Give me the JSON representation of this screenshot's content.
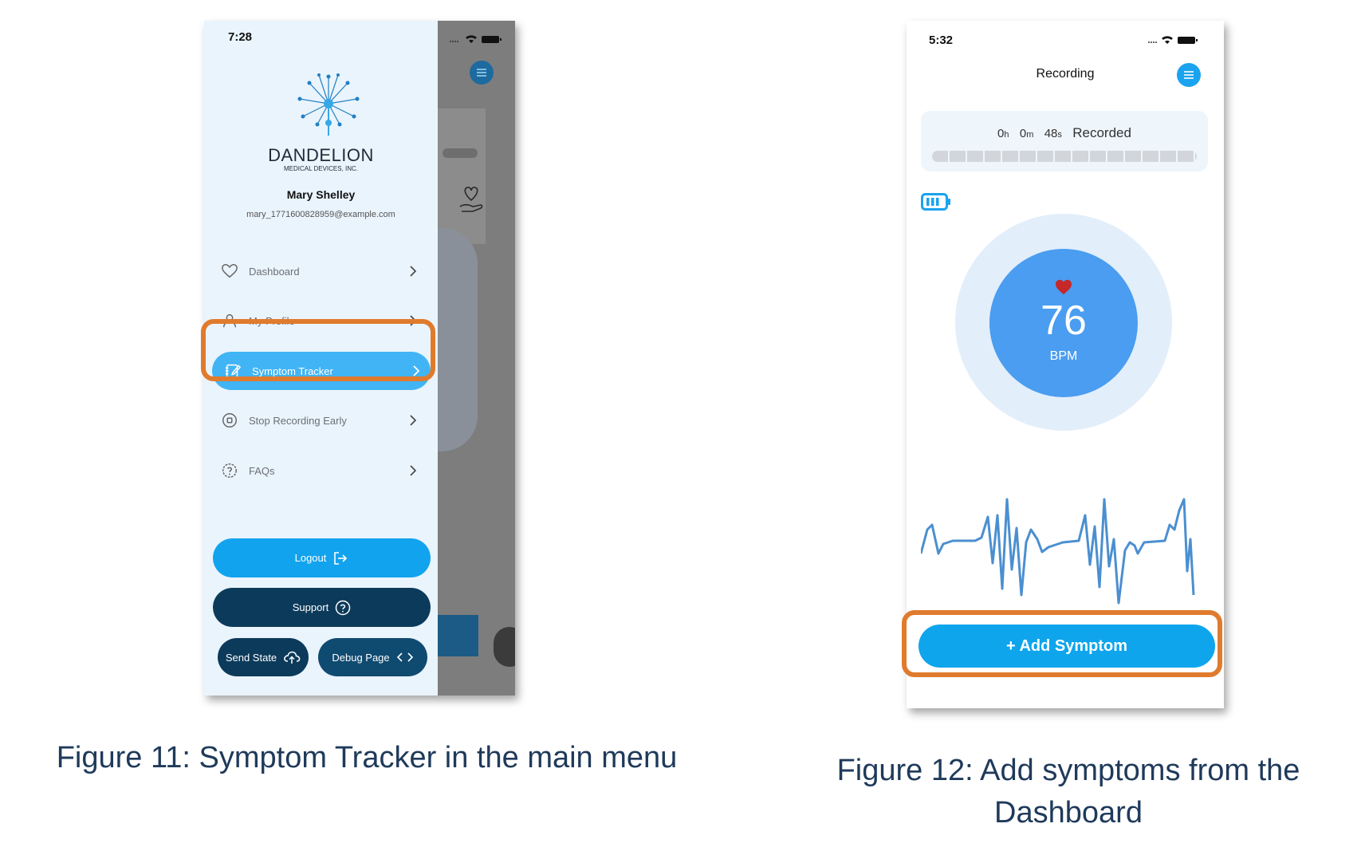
{
  "figure11": {
    "status_time": "7:28",
    "logo_text": "DANDELION",
    "logo_sub": "MEDICAL DEVICES, INC.",
    "user_name": "Mary Shelley",
    "user_email": "mary_1771600828959@example.com",
    "menu_items": [
      {
        "label": "Dashboard",
        "icon": "heart-icon"
      },
      {
        "label": "My Profile",
        "icon": "person-icon"
      },
      {
        "label": "Symptom Tracker",
        "icon": "edit-notes-icon",
        "active": true
      },
      {
        "label": "Stop Recording Early",
        "icon": "stop-circle-icon"
      },
      {
        "label": "FAQs",
        "icon": "help-circle-icon"
      }
    ],
    "logout_label": "Logout",
    "support_label": "Support",
    "send_state_label": "Send State",
    "debug_page_label": "Debug Page",
    "caption": "Figure 11: Symptom Tracker in the main menu"
  },
  "figure12": {
    "status_time": "5:32",
    "title": "Recording",
    "timer": {
      "hours": "0",
      "hours_unit": "h",
      "minutes": "0",
      "minutes_unit": "m",
      "seconds": "48",
      "seconds_unit": "s",
      "label": "Recorded"
    },
    "heart_rate": "76",
    "heart_rate_unit": "BPM",
    "add_symptom_label": "+ Add Symptom",
    "caption": "Figure 12: Add symptoms from the Dashboard"
  },
  "colors": {
    "accent_blue": "#0ea5ec",
    "dark_navy": "#0c3a5a",
    "highlight_orange": "#e07b2e",
    "caption_text": "#1f3a5a"
  }
}
